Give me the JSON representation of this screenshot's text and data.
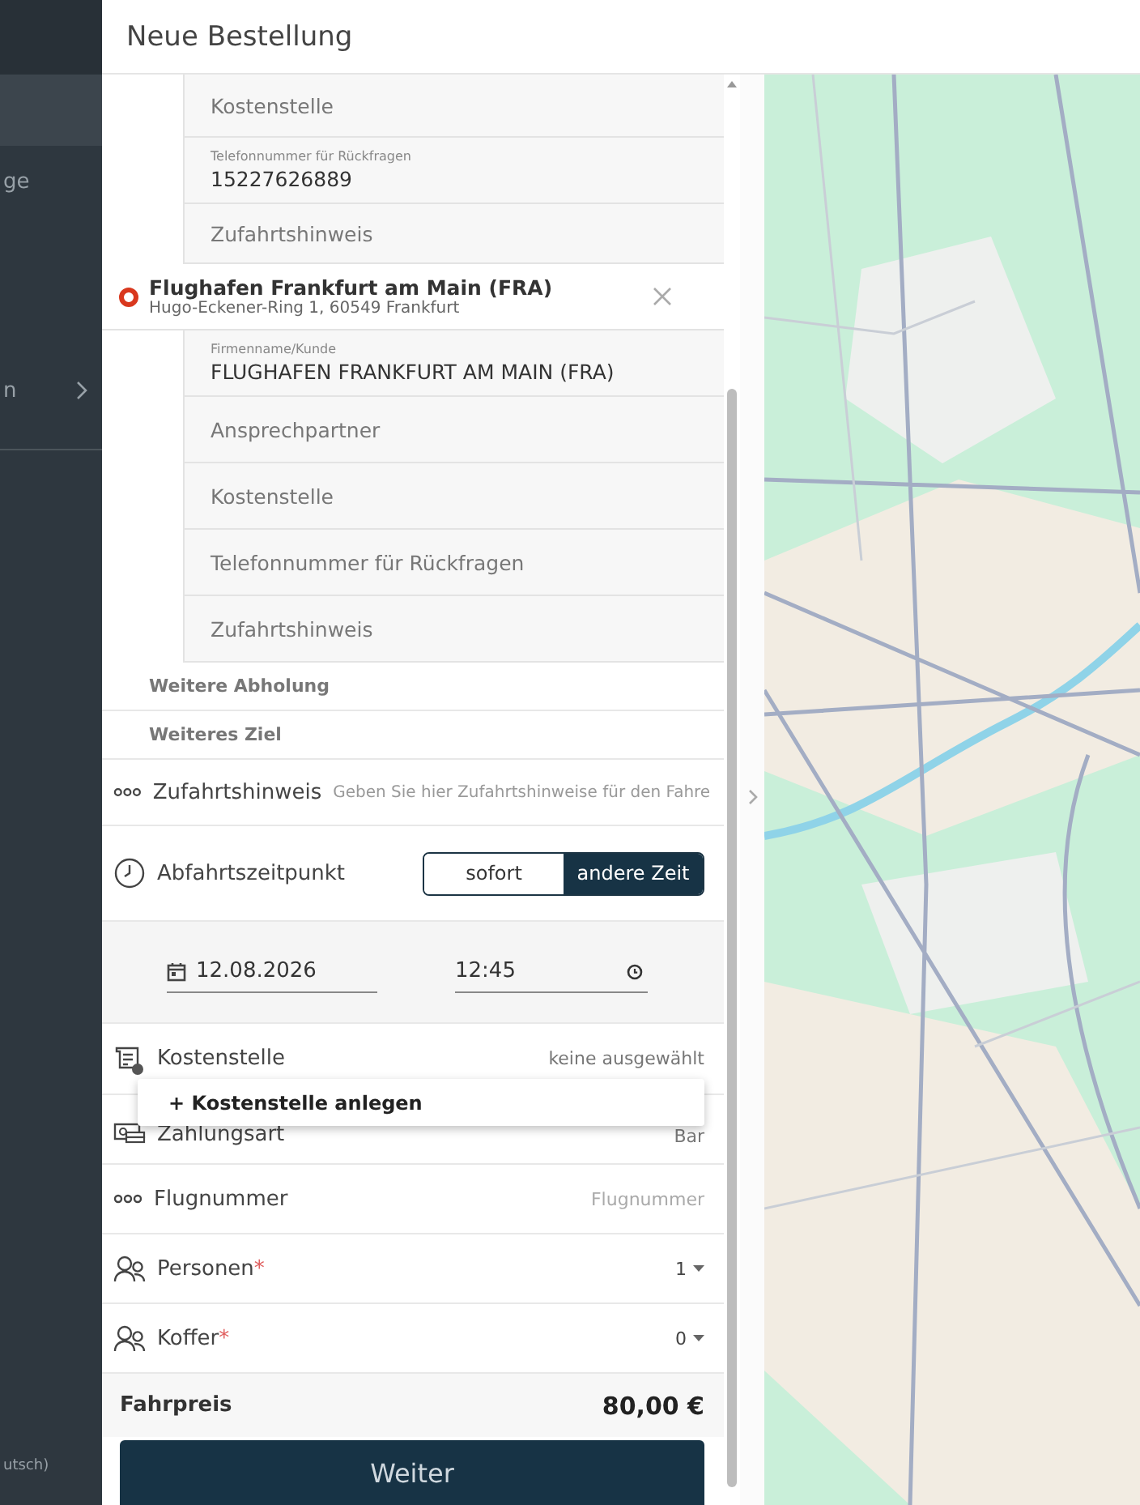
{
  "sidebar": {
    "items": [
      {
        "selected": true
      },
      {
        "label": "ge",
        "selected": false,
        "expandable": false
      },
      {
        "label": "n",
        "selected": false,
        "expandable": true
      }
    ],
    "language": "utsch)"
  },
  "header": {
    "title": "Neue Bestellung"
  },
  "previous_stop_fields": [
    {
      "placeholder": "Kostenstelle"
    },
    {
      "label": "Telefonnummer für Rückfragen",
      "value": "15227626889"
    },
    {
      "placeholder": "Zufahrtshinweis"
    }
  ],
  "destination": {
    "name": "Flughafen Frankfurt am Main (FRA)",
    "address": "Hugo-Eckener-Ring 1, 60549 Frankfurt",
    "fields": [
      {
        "label": "Firmenname/Kunde",
        "value": "FLUGHAFEN FRANKFURT AM MAIN (FRA)"
      },
      {
        "placeholder": "Ansprechpartner"
      },
      {
        "placeholder": "Kostenstelle"
      },
      {
        "placeholder": "Telefonnummer für Rückfragen"
      },
      {
        "placeholder": "Zufahrtshinweis"
      }
    ]
  },
  "add_links": [
    "Weitere Abholung",
    "Weiteres Ziel"
  ],
  "access_note": {
    "label": "Zufahrtshinweis",
    "placeholder": "Geben Sie hier Zufahrtshinweise für den Fahre"
  },
  "departure": {
    "label": "Abfahrtszeitpunkt",
    "options": [
      {
        "label": "sofort",
        "selected": false
      },
      {
        "label": "andere Zeit",
        "selected": true
      }
    ],
    "date": "12.08.2026",
    "time": "12:45"
  },
  "rows": [
    {
      "kind": "cost_center",
      "label": "Kostenstelle",
      "value": "keine ausgewählt",
      "menu": {
        "items": [
          "+ Kostenstelle anlegen"
        ]
      }
    },
    {
      "kind": "payment",
      "label": "Zahlungsart",
      "value": "Bar"
    },
    {
      "kind": "flight",
      "label": "Flugnummer",
      "placeholder": "Flugnummer"
    },
    {
      "kind": "persons",
      "label": "Personen",
      "required_mark": "*",
      "value": "1"
    },
    {
      "kind": "luggage",
      "label": "Koffer",
      "required_mark": "*",
      "value": "0"
    }
  ],
  "price": {
    "label": "Fahrpreis",
    "value": "80,00 €"
  },
  "submit": "Weiter"
}
